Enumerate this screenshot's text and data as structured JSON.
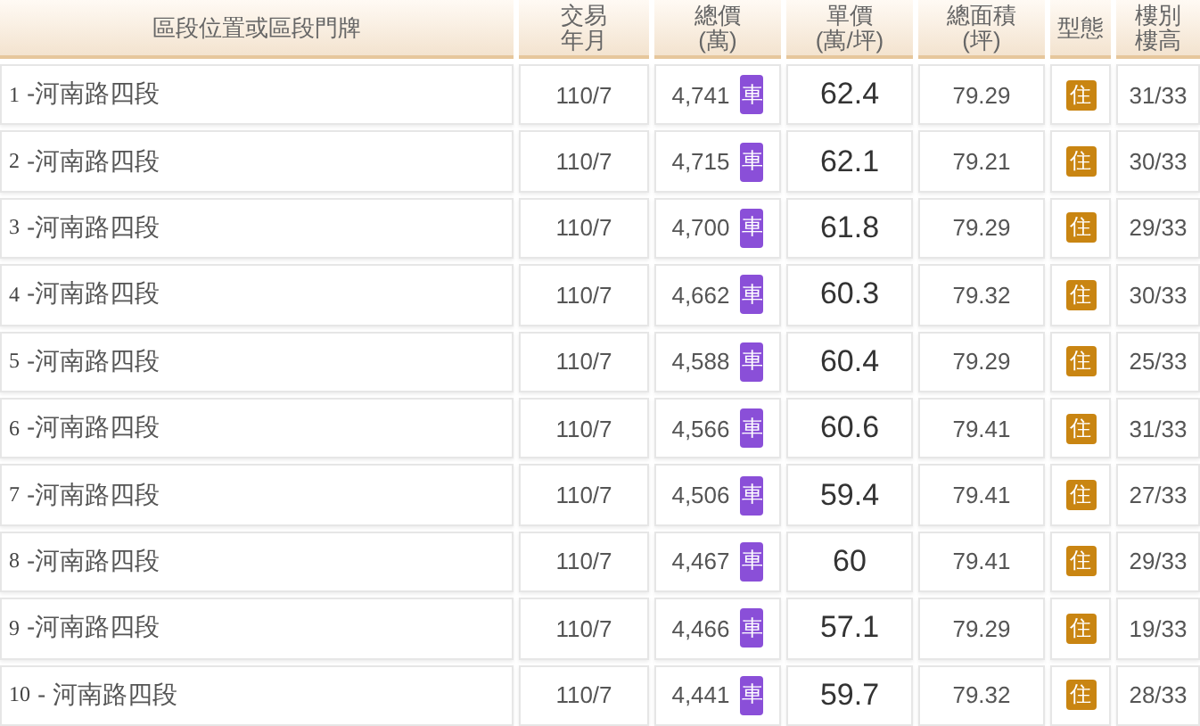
{
  "table": {
    "columns": [
      "區段位置或區段門牌",
      "交易年月",
      "總價\n(萬)",
      "單價\n(萬/坪)",
      "總面積\n(坪)",
      "型態",
      "樓別樓高"
    ],
    "rows": [
      {
        "index": "1",
        "location": "-河南路四段",
        "date": "110/7",
        "price": "4,741",
        "parking": "車",
        "unit_price": "62.4",
        "area": "79.29",
        "type": "住",
        "floor": "31/33"
      },
      {
        "index": "2",
        "location": "-河南路四段",
        "date": "110/7",
        "price": "4,715",
        "parking": "車",
        "unit_price": "62.1",
        "area": "79.21",
        "type": "住",
        "floor": "30/33"
      },
      {
        "index": "3",
        "location": "-河南路四段",
        "date": "110/7",
        "price": "4,700",
        "parking": "車",
        "unit_price": "61.8",
        "area": "79.29",
        "type": "住",
        "floor": "29/33"
      },
      {
        "index": "4",
        "location": "-河南路四段",
        "date": "110/7",
        "price": "4,662",
        "parking": "車",
        "unit_price": "60.3",
        "area": "79.32",
        "type": "住",
        "floor": "30/33"
      },
      {
        "index": "5",
        "location": "-河南路四段",
        "date": "110/7",
        "price": "4,588",
        "parking": "車",
        "unit_price": "60.4",
        "area": "79.29",
        "type": "住",
        "floor": "25/33"
      },
      {
        "index": "6",
        "location": "-河南路四段",
        "date": "110/7",
        "price": "4,566",
        "parking": "車",
        "unit_price": "60.6",
        "area": "79.41",
        "type": "住",
        "floor": "31/33"
      },
      {
        "index": "7",
        "location": "-河南路四段",
        "date": "110/7",
        "price": "4,506",
        "parking": "車",
        "unit_price": "59.4",
        "area": "79.41",
        "type": "住",
        "floor": "27/33"
      },
      {
        "index": "8",
        "location": "-河南路四段",
        "date": "110/7",
        "price": "4,467",
        "parking": "車",
        "unit_price": "60",
        "area": "79.41",
        "type": "住",
        "floor": "29/33"
      },
      {
        "index": "9",
        "location": "-河南路四段",
        "date": "110/7",
        "price": "4,466",
        "parking": "車",
        "unit_price": "57.1",
        "area": "79.29",
        "type": "住",
        "floor": "19/33"
      },
      {
        "index": "10",
        "location": "- 河南路四段",
        "date": "110/7",
        "price": "4,441",
        "parking": "車",
        "unit_price": "59.7",
        "area": "79.32",
        "type": "住",
        "floor": "28/33"
      }
    ]
  }
}
